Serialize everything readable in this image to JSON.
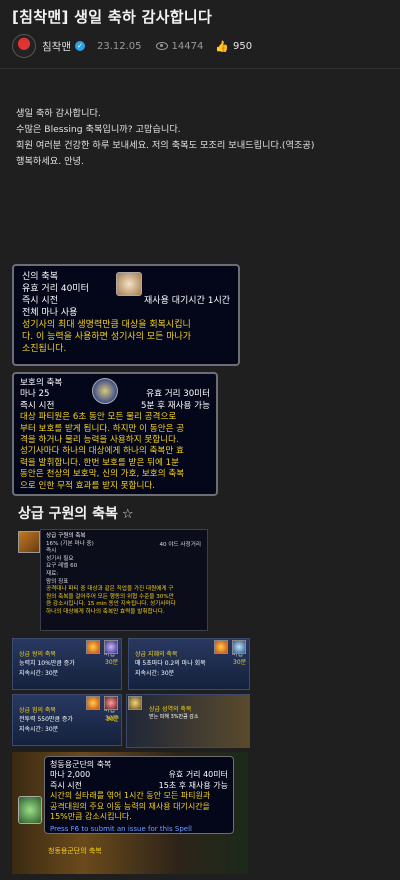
{
  "post": {
    "title": "[침착맨] 생일 축하 감사합니다",
    "author": "침착맨",
    "date": "23.12.05",
    "views": "14474",
    "likes": "950",
    "body": [
      "생일 축하 감사합니다.",
      "수많은 Blessing 축복입니까? 고맙습니다.",
      "회원 여러분 건강한 하루 보내세요. 저의 축복도 모조리 보내드립니다.(역조공)",
      "행복하세요. 안녕."
    ]
  },
  "tooltip1": {
    "name": "신의 축복",
    "range": "유효 거리 40미터",
    "cast": "즉시 시전",
    "cooldown": "재사용 대기시간 1시간",
    "cost": "전체 마나 사용",
    "desc1": "성기사의 최대 생명력만큼 대상을 회복시킵니",
    "desc2": "다. 이 능력을 사용하면 성기사의 모든 마나가",
    "desc3": "소진됩니다."
  },
  "tooltip2": {
    "name": "보호의 축복",
    "mana": "마나 25",
    "range": "유효 거리 30미터",
    "cast": "즉시 시전",
    "cooldown": "5분 후 재사용 가능",
    "desc": [
      "대상 파티원은 6초 동안 모든 물리 공격으로",
      "부터 보호를 받게 됩니다. 하지만 이 동안은 공",
      "격을 하거나 물리 능력을 사용하지 못합니다.",
      "성기사마다 하나의 대상에게 하나의 축복만 효",
      "력을 발휘합니다. 한번 보호를 받은 뒤에 1분",
      "동안은 천상의 보호막, 신의 가호, 보호의 축복",
      "으로 인한 무적 효과를 받지 못합니다."
    ]
  },
  "wowhead": {
    "title": "상급 구원의 축복",
    "star": "☆",
    "lines": [
      "상급 구원의 축복",
      "16% (기본 마나 중)",
      "즉시",
      "성기사 필요",
      "요구 레벨 60",
      "재료:",
      "  왕의 징표",
      "공격대나 파티 중 대상과 같은 직업을 가진 대원에게 구",
      "원의 축복을 걸어주어 모든 행동의 위협 수준을 30%만",
      "큼 감소시킵니다. 15 min 동안 지속됩니다. 성기사마다",
      "하나의 대상에게 하나의 축복만 효력을 발휘합니다."
    ],
    "range": "40 야드 사정거리"
  },
  "buffs": [
    {
      "name": "상급 왕의 축복",
      "tag": "마법",
      "desc": "능력치 10%만큼 증가",
      "time": "지속시간: 30분",
      "dur": "30분"
    },
    {
      "name": "상급 지혜의 축복",
      "tag": "마법",
      "desc": "매 5초마다 0.2의 마나 회복",
      "time": "지속시간: 30분",
      "dur": "30분"
    },
    {
      "name": "상급 힘의 축복",
      "tag": "마법",
      "desc": "전투력 550만큼 증가",
      "time": "지속시간: 30분",
      "dur": "30분"
    },
    {
      "name": "상급 성역의 축복",
      "tag": "",
      "desc": "받는 피해 3%만큼 감소",
      "time": "",
      "dur": "30분"
    }
  ],
  "tooltip3": {
    "name": "청동용군단의 축복",
    "mana": "마나 2,000",
    "range": "유효 거리 40미터",
    "cast": "즉시 시전",
    "cooldown": "15초 후 재사용 가능",
    "desc": [
      "시간의 실타래를 엮어 1시간 동안 모든 파티원과",
      "공격대원의 주요 이동 능력의 재사용 대기시간을",
      "15%만큼 감소시킵니다."
    ],
    "help": "Press F6 to submit an issue for this Spell",
    "caption": "청동용군단의 축복"
  }
}
